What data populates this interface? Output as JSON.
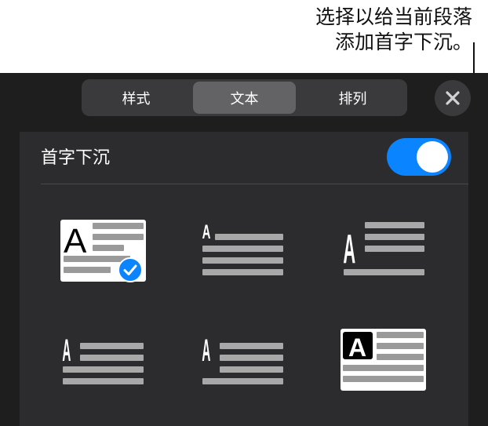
{
  "callout": {
    "line1": "选择以给当前段落",
    "line2": "添加首字下沉。"
  },
  "segmented_control": {
    "tabs": [
      {
        "label": "样式",
        "active": false
      },
      {
        "label": "文本",
        "active": true
      },
      {
        "label": "排列",
        "active": false
      }
    ]
  },
  "close_button": {
    "icon": "close-icon"
  },
  "drop_cap": {
    "label": "首字下沉",
    "enabled": true,
    "accent_color": "#0a84ff"
  },
  "styles": [
    {
      "glyph": "A",
      "selected": true
    },
    {
      "glyph": "A",
      "selected": false
    },
    {
      "glyph": "A",
      "selected": false
    },
    {
      "glyph": "A",
      "selected": false
    },
    {
      "glyph": "A",
      "selected": false
    },
    {
      "glyph": "A",
      "selected": false
    }
  ]
}
